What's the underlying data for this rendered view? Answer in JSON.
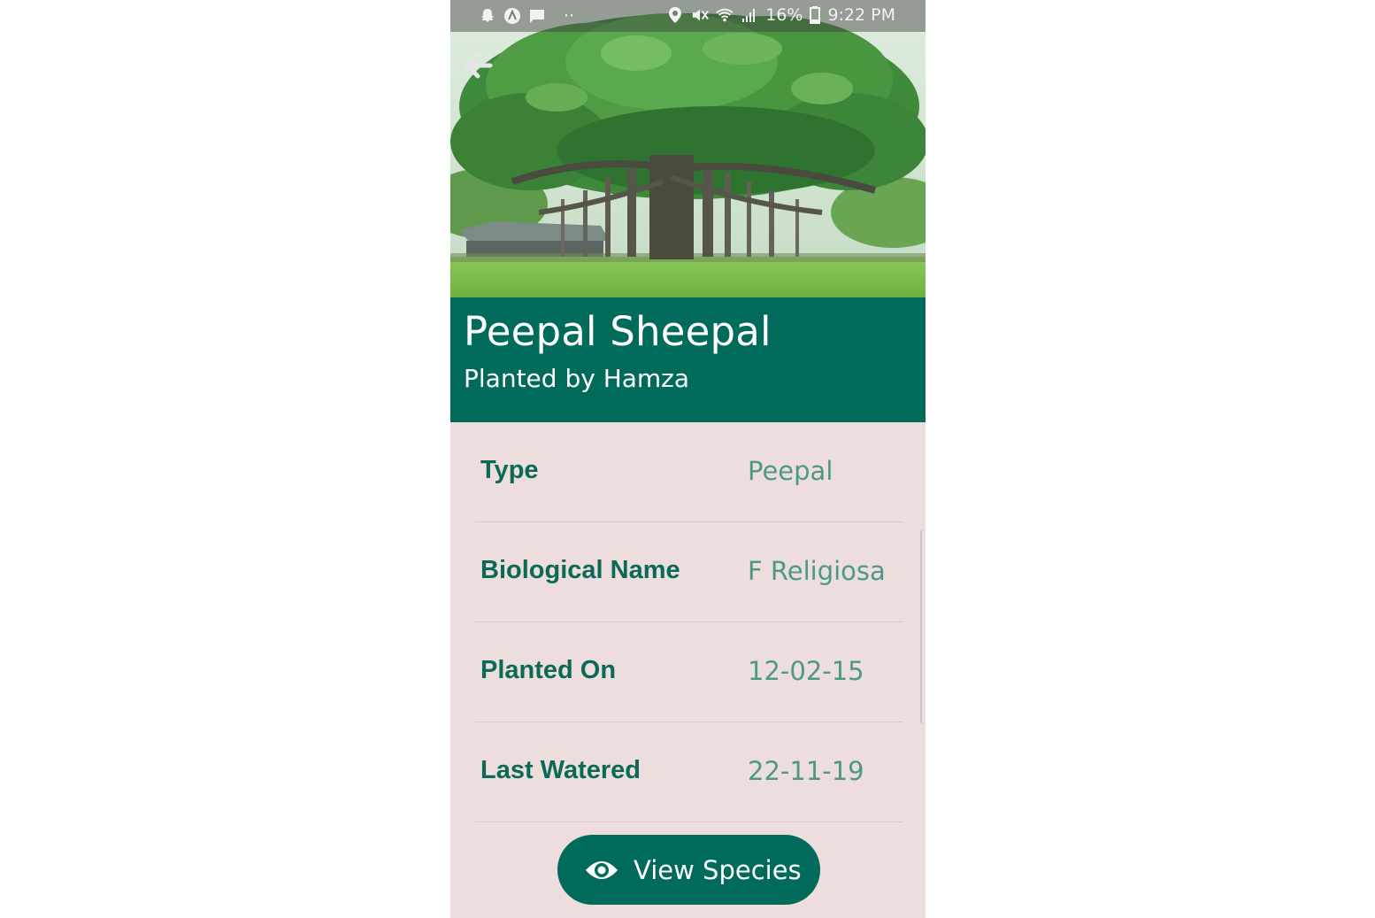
{
  "status_bar": {
    "battery": "16%",
    "time": "9:22 PM",
    "dots": "··"
  },
  "hero": {
    "image": "banyan-tree-photo"
  },
  "header": {
    "title": "Peepal Sheepal",
    "subtitle": "Planted by Hamza"
  },
  "details": [
    {
      "label": "Type",
      "value": "Peepal"
    },
    {
      "label": "Biological Name",
      "value": "F Religiosa"
    },
    {
      "label": "Planted On",
      "value": "12-02-15"
    },
    {
      "label": "Last Watered",
      "value": "22-11-19"
    }
  ],
  "action": {
    "label": "View Species",
    "icon": "eye-icon"
  },
  "colors": {
    "primary": "#006b5b",
    "background": "#eedddd",
    "label": "#0b6a57",
    "value": "#4c9a86"
  }
}
